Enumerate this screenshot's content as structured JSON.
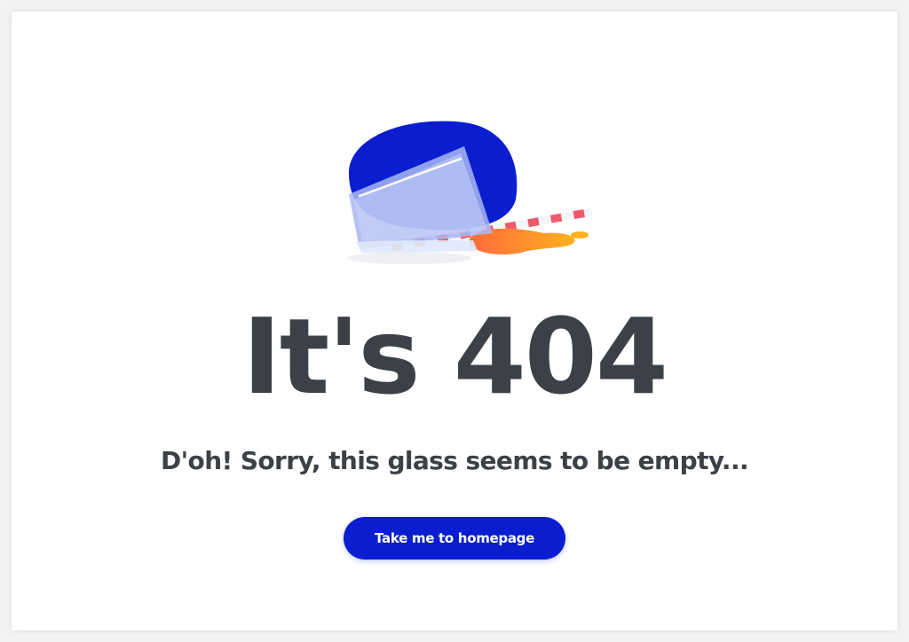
{
  "page": {
    "headline": "It's 404",
    "message": "D'oh! Sorry, this glass seems to be empty...",
    "button_label": "Take me to homepage"
  },
  "illustration": {
    "icon": "spilled-glass-illustration",
    "colors": {
      "blob": "#0a1ed0",
      "glass": "#8fa2ee",
      "spill": "#ff9a1e",
      "stripe": "#f05a6a"
    }
  },
  "colors": {
    "text": "#3c4147",
    "accent": "#0a1ed0",
    "background": "#ffffff"
  }
}
